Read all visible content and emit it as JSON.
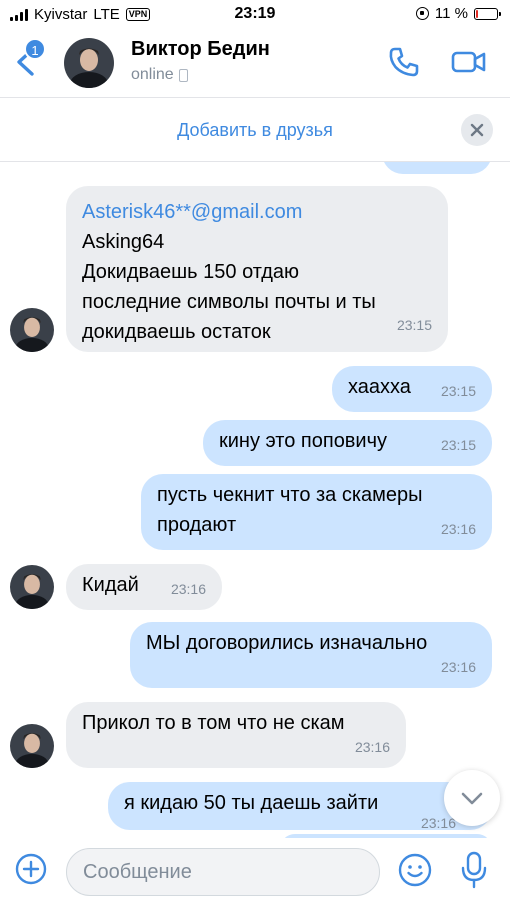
{
  "status_bar": {
    "carrier": "Kyivstar",
    "network": "LTE",
    "vpn": "VPN",
    "time": "23:19",
    "battery_percent": "11 %",
    "battery_level": 0.11
  },
  "header": {
    "unread_count": "1",
    "contact_name": "Виктор Бедин",
    "contact_status": "online"
  },
  "add_friend": {
    "label": "Добавить в друзья"
  },
  "messages": [
    {
      "direction": "in",
      "lines": [
        "Asterisk46**@gmail.com",
        "Asking64",
        "Докидваешь 150 отдаю",
        "последние символы почты и ты",
        "докидваешь остаток"
      ],
      "time": "23:15"
    },
    {
      "direction": "out",
      "text": "хаахха",
      "time": "23:15"
    },
    {
      "direction": "out",
      "text": "кину это поповичу",
      "time": "23:15"
    },
    {
      "direction": "out",
      "lines": [
        "пусть чекнит что за скамеры",
        "продают"
      ],
      "time": "23:16"
    },
    {
      "direction": "in",
      "text": "Кидай",
      "time": "23:16"
    },
    {
      "direction": "out",
      "text": "МЫ договорились изначально",
      "time": "23:16"
    },
    {
      "direction": "in",
      "text": "Прикол то в том что не скам",
      "time": "23:16"
    },
    {
      "direction": "out",
      "text": "я кидаю 50 ты даешь зайти",
      "time": "23:16"
    }
  ],
  "composer": {
    "placeholder": "Сообщение"
  },
  "colors": {
    "accent": "#3f8ae0",
    "incoming_bubble": "#ebedf0",
    "outgoing_bubble": "#cce4ff",
    "secondary_text": "#818c99",
    "battery_low": "#e32c25"
  },
  "icons": {
    "back": "chevron-left-icon",
    "call": "phone-icon",
    "video": "video-camera-icon",
    "close": "close-icon",
    "attach": "plus-circle-icon",
    "emoji": "smile-icon",
    "mic": "microphone-icon",
    "scroll": "chevron-down-icon"
  }
}
